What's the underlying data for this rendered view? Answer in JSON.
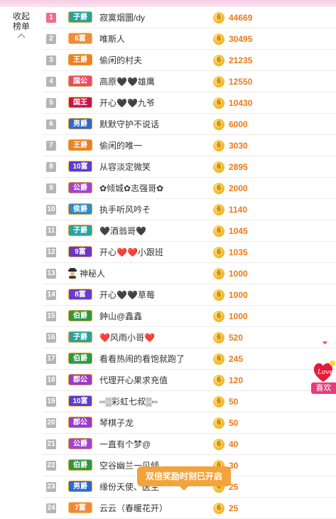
{
  "collapse_label_1": "收起",
  "collapse_label_2": "榜单",
  "coin_symbol": "6",
  "tooltip": "双倍奖励时刻已开启",
  "side_gift_label": "喜欢",
  "side_gift_logo": "Love",
  "rows": [
    {
      "rank": "1",
      "badge": "子爵",
      "badge_class": "zijue",
      "name": "寂寞烟圜/dy",
      "score": "44669"
    },
    {
      "rank": "2",
      "badge": "6富",
      "badge_class": "fu",
      "name": "唯斯人",
      "score": "30495"
    },
    {
      "rank": "3",
      "badge": "王爵",
      "badge_class": "wangjue",
      "name": "偷闲的村夫",
      "score": "21235"
    },
    {
      "rank": "4",
      "badge": "国公",
      "badge_class": "guogong",
      "name": "高原🖤🖤雄鹰",
      "score": "12550"
    },
    {
      "rank": "5",
      "badge": "国王",
      "badge_class": "guowang",
      "name": "开心🖤🖤九爷",
      "score": "10430"
    },
    {
      "rank": "6",
      "badge": "男爵",
      "badge_class": "nanjue",
      "name": "默默守护不说话",
      "score": "6000"
    },
    {
      "rank": "7",
      "badge": "王爵",
      "badge_class": "wangjue",
      "name": "偷闲的唯一",
      "score": "3030"
    },
    {
      "rank": "8",
      "badge": "10富",
      "badge_class": "fu10",
      "name": "从容淡定微笑",
      "score": "2895"
    },
    {
      "rank": "9",
      "badge": "公爵",
      "badge_class": "gongjue",
      "name": "✿倾城✿志强哥✿",
      "score": "2000"
    },
    {
      "rank": "10",
      "badge": "侯爵",
      "badge_class": "houjue",
      "name": "执手听风吟そ",
      "score": "1140"
    },
    {
      "rank": "11",
      "badge": "子爵",
      "badge_class": "zijue",
      "name": "🖤酒翁哥🖤",
      "score": "1045"
    },
    {
      "rank": "12",
      "badge": "9富",
      "badge_class": "fu9",
      "name": "开心❤️❤️小跟班",
      "score": "1035"
    },
    {
      "rank": "13",
      "badge": "",
      "badge_class": "",
      "name": "神秘人",
      "score": "1000"
    },
    {
      "rank": "14",
      "badge": "8富",
      "badge_class": "fu8",
      "name": "开心🖤🖤草莓",
      "score": "1000"
    },
    {
      "rank": "15",
      "badge": "伯爵",
      "badge_class": "bojue",
      "name": "鈡山@鑫鑫",
      "score": "1000"
    },
    {
      "rank": "16",
      "badge": "子爵",
      "badge_class": "zijue",
      "name": "❤️风雨小哥❤️",
      "score": "520"
    },
    {
      "rank": "17",
      "badge": "伯爵",
      "badge_class": "bojue",
      "name": "看看热闹的看饱就跑了",
      "score": "245"
    },
    {
      "rank": "18",
      "badge": "郡公",
      "badge_class": "jungong",
      "name": "代理开心果求充值",
      "score": "120"
    },
    {
      "rank": "19",
      "badge": "10富",
      "badge_class": "fu10",
      "name": "▫▫▒彩虹七叔▒▫▫",
      "score": "50"
    },
    {
      "rank": "20",
      "badge": "郡公",
      "badge_class": "jungong",
      "name": "琴棋子龙",
      "score": "50"
    },
    {
      "rank": "21",
      "badge": "公爵",
      "badge_class": "gongjue",
      "name": "一直有个梦@",
      "score": "40"
    },
    {
      "rank": "22",
      "badge": "伯爵",
      "badge_class": "bojue",
      "name": "空谷幽兰一见倾",
      "score": "30"
    },
    {
      "rank": "23",
      "badge": "男爵",
      "badge_class": "nanjue",
      "name": "缘份天使、医生",
      "score": "25"
    },
    {
      "rank": "24",
      "badge": "7富",
      "badge_class": "fu7",
      "name": "云云（春暖花开）",
      "score": "25"
    }
  ]
}
